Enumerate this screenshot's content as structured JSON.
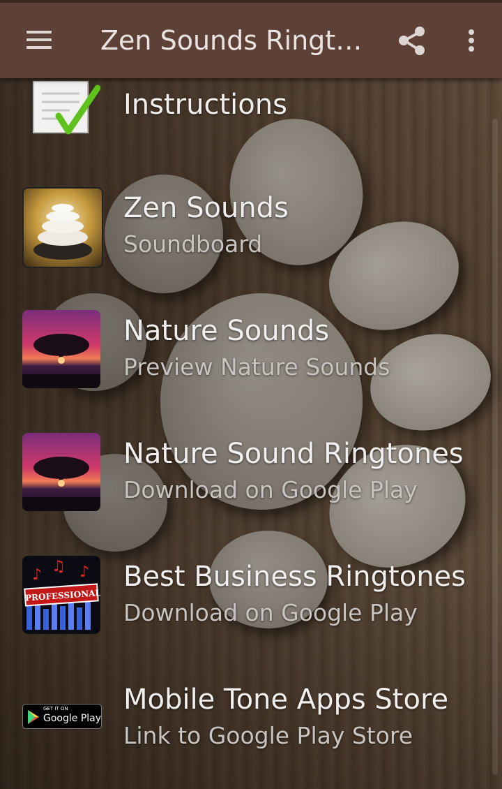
{
  "appbar": {
    "title": "Zen Sounds Ringto...",
    "menu_icon": "hamburger-menu-icon",
    "share_icon": "share-icon",
    "more_icon": "more-vert-icon"
  },
  "list": {
    "items": [
      {
        "title": "Instructions",
        "subtitle": "",
        "icon": "instructions-checkmark-icon"
      },
      {
        "title": "Zen Sounds",
        "subtitle": "Soundboard",
        "icon": "zen-stones-icon"
      },
      {
        "title": "Nature Sounds",
        "subtitle": "Preview Nature Sounds",
        "icon": "sunset-tree-icon"
      },
      {
        "title": "Nature Sound Ringtones",
        "subtitle": "Download on Google Play",
        "icon": "sunset-tree-icon"
      },
      {
        "title": "Best Business Ringtones",
        "subtitle": "Download on Google Play",
        "icon": "professional-music-icon"
      },
      {
        "title": "Mobile Tone Apps Store",
        "subtitle": "Link to Google Play Store",
        "icon": "google-play-badge-icon"
      }
    ]
  },
  "badges": {
    "professional_text": "PROFESSIONAL",
    "google_play_top": "GET IT ON",
    "google_play_name": "Google Play"
  },
  "colors": {
    "appbar": "#5d4136",
    "text_primary": "#f2f0ee",
    "text_secondary": "#c9c4c0"
  }
}
